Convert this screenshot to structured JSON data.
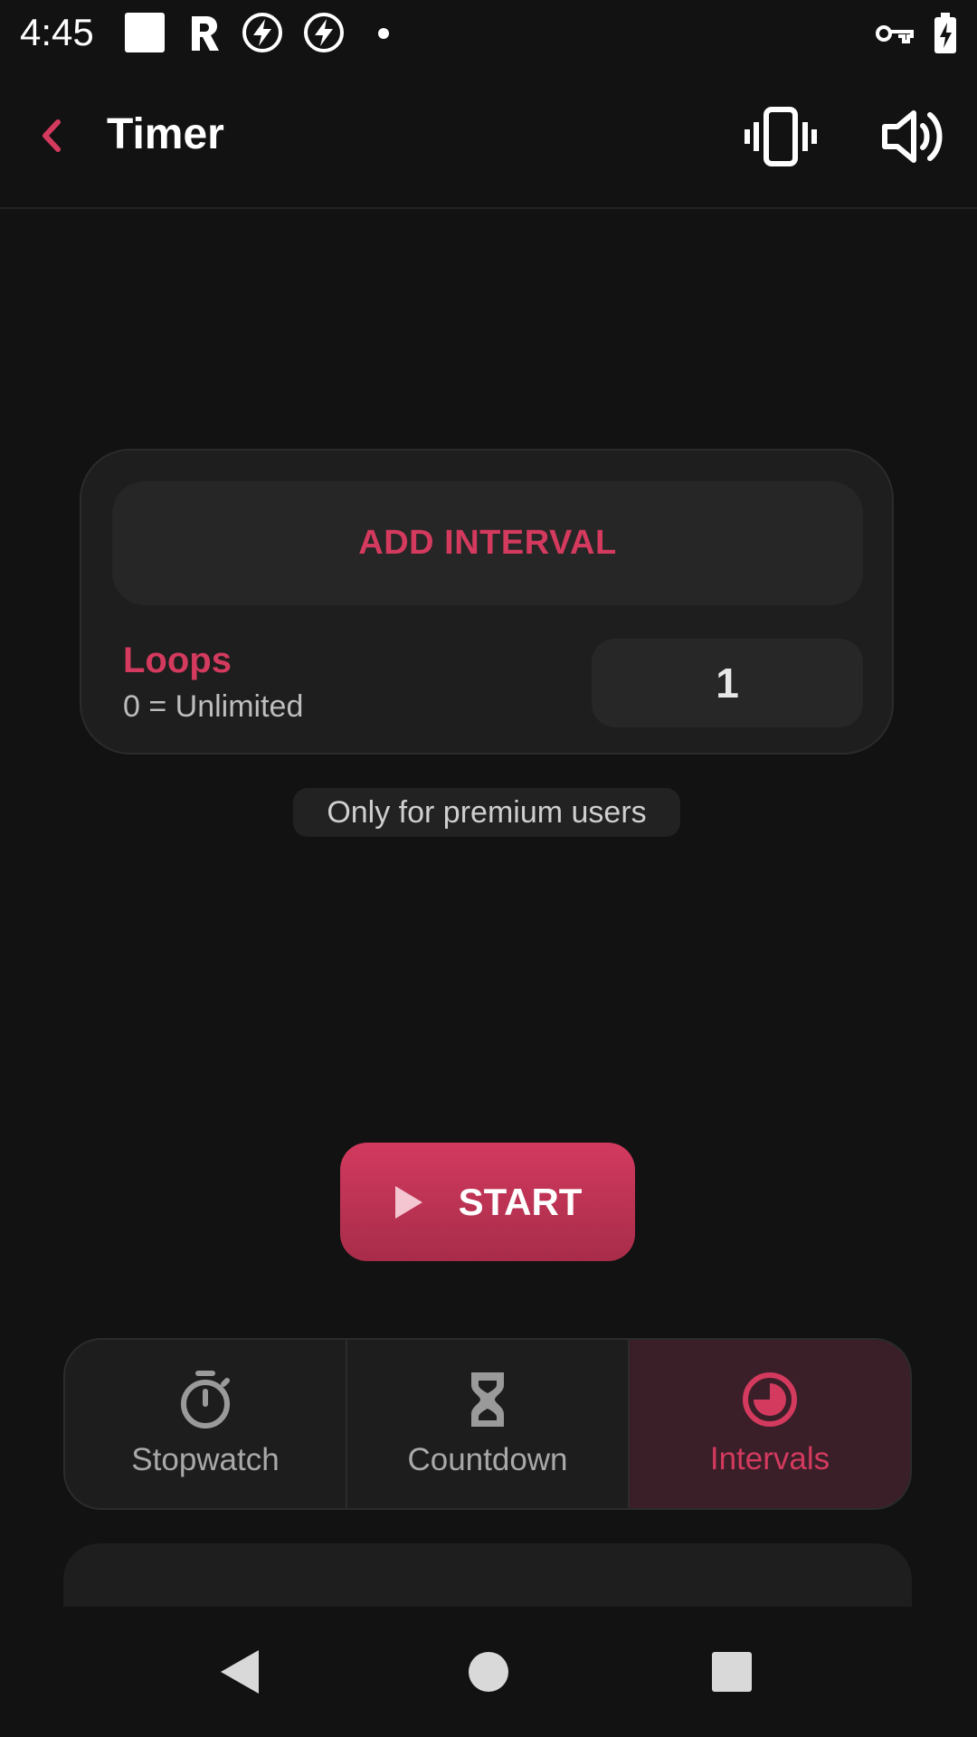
{
  "status_bar": {
    "time": "4:45",
    "icons": [
      "square-notification-icon",
      "r-app-icon",
      "bolt-icon",
      "bolt-icon",
      "dot-icon",
      "vpn-key-icon",
      "battery-charging-icon"
    ]
  },
  "app_bar": {
    "title": "Timer",
    "back_icon": "chevron-left-icon",
    "vibrate_icon": "vibrate-icon",
    "sound_icon": "volume-icon"
  },
  "intervals": {
    "add_label": "ADD INTERVAL",
    "loops_label": "Loops",
    "loops_hint": "0 = Unlimited",
    "loops_value": "1",
    "premium_note": "Only for premium users"
  },
  "start_button": {
    "label": "START",
    "icon": "play-icon"
  },
  "mode_tabs": [
    {
      "label": "Stopwatch",
      "icon": "stopwatch-icon",
      "active": false
    },
    {
      "label": "Countdown",
      "icon": "hourglass-icon",
      "active": false
    },
    {
      "label": "Intervals",
      "icon": "intervals-icon",
      "active": true
    }
  ],
  "colors": {
    "accent": "#d33a5e",
    "background": "#121212",
    "card": "#1e1e1e",
    "active_tab": "#3a1f29"
  },
  "nav_bar": {
    "back": "nav-back-icon",
    "home": "nav-home-icon",
    "recents": "nav-recents-icon"
  }
}
